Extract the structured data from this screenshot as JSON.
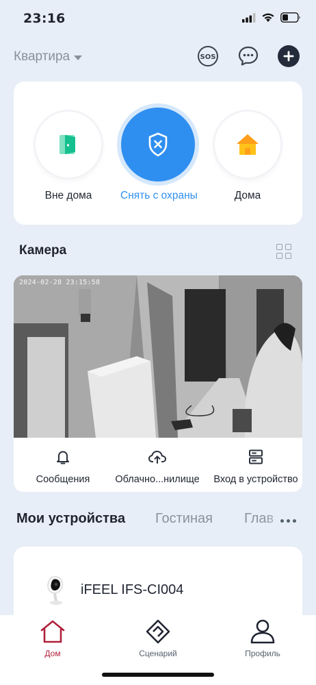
{
  "status": {
    "time": "23:16"
  },
  "header": {
    "home_name": "Квартира",
    "sos_label": "SOS"
  },
  "modes": [
    {
      "label": "Вне дома"
    },
    {
      "label": "Снять с охраны"
    },
    {
      "label": "Дома"
    }
  ],
  "camera": {
    "section_title": "Камера",
    "timestamp": "2024-02-28  23:15:58",
    "actions": [
      {
        "label": "Сообщения"
      },
      {
        "label": "Облачно...нилище"
      },
      {
        "label": "Вход в устройство"
      }
    ]
  },
  "devices": {
    "tabs": [
      "Мои устройства",
      "Гостиная",
      "Глав"
    ],
    "items": [
      {
        "name": "iFEEL IFS-CI004"
      }
    ]
  },
  "tabbar": [
    {
      "label": "Дом"
    },
    {
      "label": "Сценарий"
    },
    {
      "label": "Профиль"
    }
  ],
  "colors": {
    "accent": "#2f8ff0",
    "active_tab": "#b0203a",
    "background": "#e8eef7"
  }
}
